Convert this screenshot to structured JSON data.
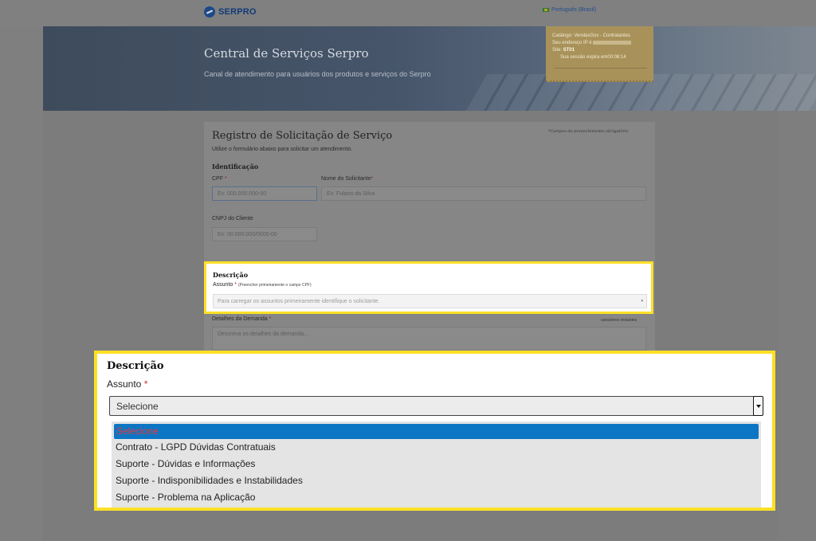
{
  "header": {
    "logo_text": "SERPRO",
    "language": "Português (Brasil)"
  },
  "banner": {
    "title": "Central de Serviços Serpro",
    "subtitle": "Canal de atendimento para usuários dos produtos e serviços do Serpro"
  },
  "session": {
    "catalog": "Catálogo: VendasGov - Contratantes",
    "ip_label": "Seu endereço IP é",
    "site_label": "Site:",
    "site_value": "ST01",
    "expires_label": "Sua sessão expira em",
    "expires_value": "00:08:14"
  },
  "form": {
    "title": "Registro de Solicitação de Serviço",
    "hint": "Utilize o formulário abaixo para solicitar um atendimento.",
    "required_note": "*Campos de preenchimento obrigatório",
    "identification": "Identificação",
    "cpf_label": "CPF",
    "cpf_placeholder": "Ex: 000.000.000-00",
    "name_label": "Nome do Solicitante",
    "name_placeholder": "Ex: Fulano da Silva",
    "cnpj_label": "CNPJ do Cliente",
    "cnpj_placeholder": "Ex: 00.000.000/0000-00",
    "details_label": "Detalhes da Demanda",
    "details_placeholder": "Descreva os detalhes da demanda...",
    "chars_remaining": "caracteres restantes"
  },
  "description_small": {
    "heading": "Descrição",
    "subject_label": "Assunto",
    "subject_hint": "(Preencher primeiramente o campo CPF)",
    "select_placeholder": "Para carregar os assuntos primeiramente identifique o solicitante."
  },
  "description_zoom": {
    "heading": "Descrição",
    "subject_label": "Assunto",
    "selected": "Selecione",
    "options": [
      "Selecione",
      "Contrato - LGPD Dúvidas Contratuais",
      "Suporte - Dúvidas e Informações",
      "Suporte - Indisponibilidades e Instabilidades",
      "Suporte - Problema na Aplicação"
    ]
  },
  "colors": {
    "highlight": "#fde026",
    "selected_option": "#0d76c4",
    "required_star": "#c33333"
  }
}
